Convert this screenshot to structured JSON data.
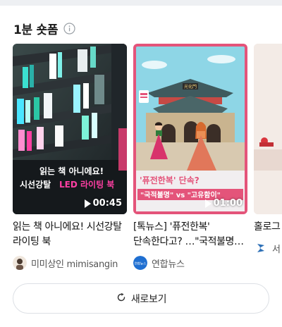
{
  "section": {
    "title": "1분 숏폼"
  },
  "cards": [
    {
      "overlay_line1": "읽는 책 아니에요!",
      "overlay_line2_a": "시선강탈",
      "overlay_line2_b": "LED 라이팅 북",
      "duration": "00:45",
      "title": "읽는 책 아니에요! 시선강탈 라이팅 북",
      "source": "미미상인 mimisangin"
    },
    {
      "overlay_caption": "'퓨전한복' 단속?",
      "overlay_banner": "\"국적불명\" vs \"고유함이\"",
      "gate_sign": "光化門",
      "duration": "01:00",
      "title": "[톡뉴스] '퓨전한복' 단속한다고? …\"국적불명\" v…",
      "source": "연합뉴스",
      "source_logo_text": "연합뉴스"
    },
    {
      "title": "홀로그 사진 [",
      "source": "서"
    }
  ],
  "refresh_button": {
    "label": "새로보기"
  },
  "colors": {
    "accent_pink": "#e4547a",
    "led_pink": "#ff3fa3",
    "yonhap_blue": "#1f6fd1"
  },
  "icons": {
    "info": "info-circle-icon",
    "play": "play-icon",
    "refresh": "refresh-icon"
  }
}
